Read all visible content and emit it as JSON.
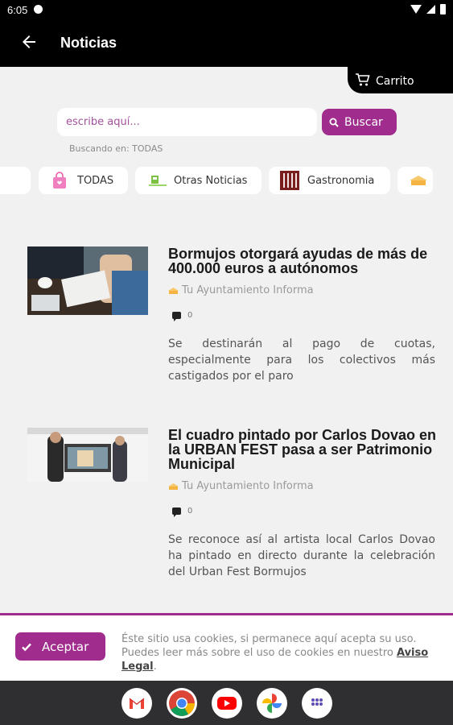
{
  "status_bar": {
    "time": "6:05"
  },
  "app_bar": {
    "title": "Noticias"
  },
  "cart": {
    "label": "Carrito"
  },
  "search": {
    "placeholder": "escribe aquí...",
    "button_label": "Buscar",
    "scope_text": "Buscando en: TODAS"
  },
  "categories": [
    {
      "label": "TODAS",
      "icon": "shopping-bag-icon"
    },
    {
      "label": "Otras Noticias",
      "icon": "news-icon"
    },
    {
      "label": "Gastronomia",
      "icon": "cutlery-icon"
    }
  ],
  "articles": [
    {
      "title": "Bormujos otorgará ayudas de más de 400.000 euros a autónomos",
      "category": "Tu Ayuntamiento Informa",
      "comments": "0",
      "excerpt": "Se destinarán al pago de cuotas, especialmente para los colectivos más castigados por el paro"
    },
    {
      "title": "El cuadro pintado por Carlos Dovao en la URBAN FEST pasa a ser Patrimonio Municipal",
      "category": "Tu Ayuntamiento Informa",
      "comments": "0",
      "excerpt": "Se reconoce así al artista local Carlos Dovao ha pintado en directo durante la celebración del Urban Fest Bormujos"
    }
  ],
  "cookies": {
    "accept_label": "Aceptar",
    "text": "Éste sitio usa cookies, si permanece aquí acepta su uso. Puedes leer más sobre el uso de cookies en nuestro",
    "link": "Aviso Legal",
    "trailing": "."
  },
  "dock": [
    "gmail-icon",
    "chrome-icon",
    "youtube-icon",
    "photos-icon",
    "app-drawer-icon"
  ],
  "colors": {
    "accent": "#a02d8e",
    "header": "#000000",
    "background": "#f1f1f1"
  }
}
